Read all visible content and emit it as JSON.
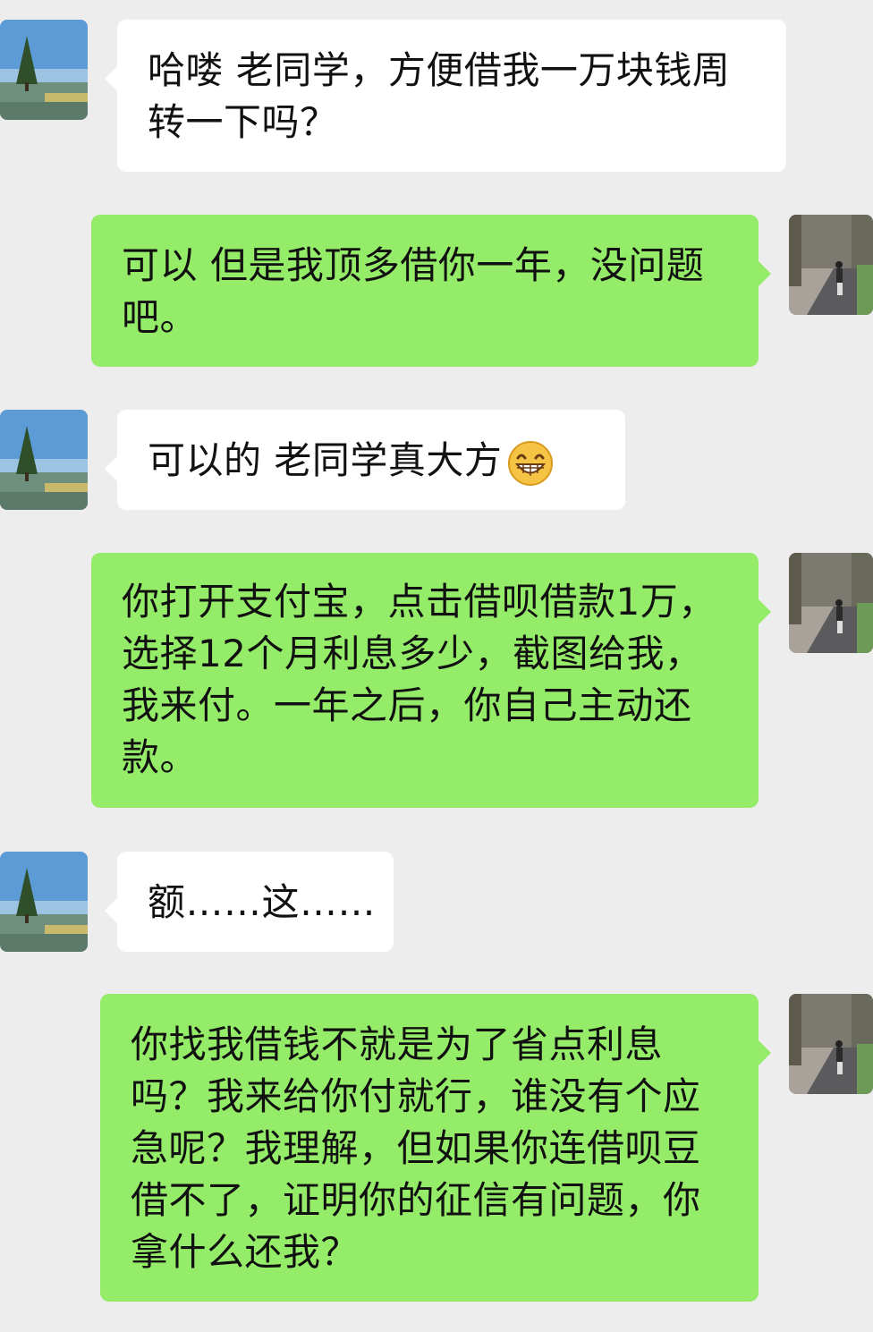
{
  "messages": [
    {
      "side": "in",
      "text": "哈喽 老同学，方便借我一万块钱周转一下吗？"
    },
    {
      "side": "out",
      "text": "可以 但是我顶多借你一年，没问题吧。"
    },
    {
      "side": "in",
      "text": "可以的 老同学真大方",
      "emoji": "grinning-face-icon"
    },
    {
      "side": "out",
      "text": "你打开支付宝，点击借呗借款1万，选择12个月利息多少，截图给我，我来付。一年之后，你自己主动还款。"
    },
    {
      "side": "in",
      "text": "额……这……"
    },
    {
      "side": "out",
      "text": "你找我借钱不就是为了省点利息吗？我来给你付就行，谁没有个应急呢？我理解，但如果你连借呗豆借不了，证明你的征信有问题，你拿什么还我？"
    }
  ],
  "avatars": {
    "contact": "tree-landscape-avatar",
    "self": "street-walker-avatar"
  },
  "colors": {
    "background": "#EDEDED",
    "incoming_bubble": "#FFFFFF",
    "outgoing_bubble": "#95EC69",
    "text": "#111111"
  }
}
